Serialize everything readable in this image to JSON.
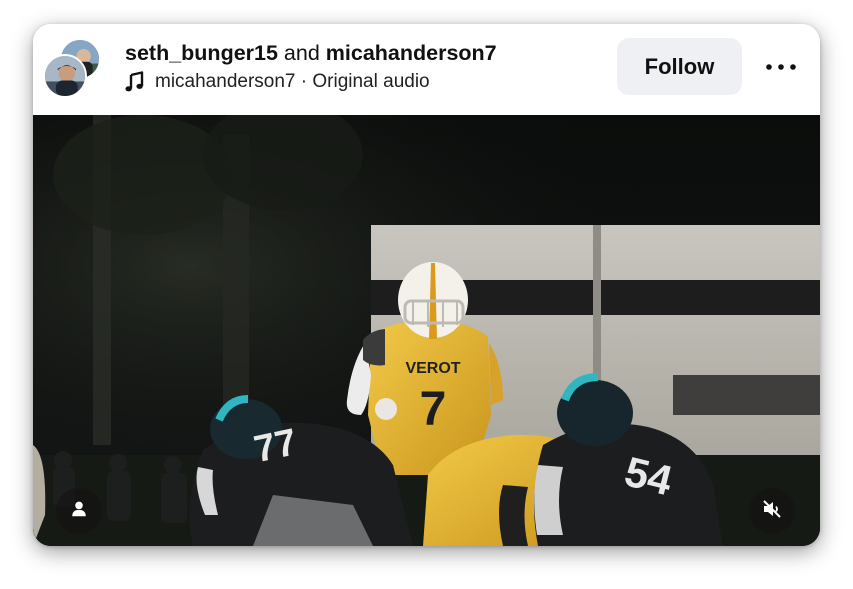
{
  "post": {
    "author1": "seth_bunger15",
    "connector": " and ",
    "author2": "micahanderson7",
    "audio_owner": "micahanderson7",
    "audio_sep": " · ",
    "audio_label": "Original audio",
    "follow_label": "Follow"
  },
  "jersey": {
    "qb_team": "VEROT",
    "qb_number": "7",
    "lineman_left": "77",
    "lineman_right": "54"
  },
  "icons": {
    "music": "music-note-icon",
    "more": "more-horizontal-icon",
    "user": "user-tag-icon",
    "mute": "speaker-muted-icon"
  },
  "colors": {
    "follow_bg": "#eef0f3",
    "text": "#111111",
    "team_gold": "#e8b62c",
    "opponent_black": "#1c1d1f",
    "opponent_teal": "#2fb6c1"
  }
}
